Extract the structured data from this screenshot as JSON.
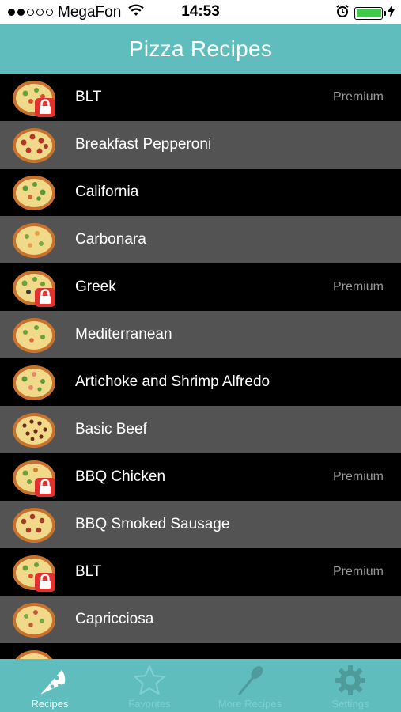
{
  "status_bar": {
    "carrier": "MegaFon",
    "time": "14:53"
  },
  "header": {
    "title": "Pizza Recipes"
  },
  "recipes": [
    {
      "name": "BLT",
      "badge": "Premium"
    },
    {
      "name": "Breakfast Pepperoni",
      "badge": ""
    },
    {
      "name": "California",
      "badge": ""
    },
    {
      "name": "Carbonara",
      "badge": ""
    },
    {
      "name": "Greek",
      "badge": "Premium"
    },
    {
      "name": "Mediterranean",
      "badge": ""
    },
    {
      "name": "Artichoke and Shrimp Alfredo",
      "badge": ""
    },
    {
      "name": "Basic Beef",
      "badge": ""
    },
    {
      "name": "BBQ Chicken",
      "badge": "Premium"
    },
    {
      "name": "BBQ Smoked Sausage",
      "badge": ""
    },
    {
      "name": "BLT",
      "badge": "Premium"
    },
    {
      "name": "Capricciosa",
      "badge": ""
    },
    {
      "name": "",
      "badge": ""
    }
  ],
  "tab_bar": {
    "tabs": [
      {
        "label": "Recipes",
        "icon": "pizza-slice-icon"
      },
      {
        "label": "Favorites",
        "icon": "star-icon"
      },
      {
        "label": "More Recipes",
        "icon": "whisk-icon"
      },
      {
        "label": "Settings",
        "icon": "gear-icon"
      }
    ]
  },
  "colors": {
    "accent": "#5fbdbd",
    "row_dark": "#000000",
    "row_gray": "#535353",
    "badge_text": "#9a9a9a",
    "battery": "#3dcc4a"
  }
}
